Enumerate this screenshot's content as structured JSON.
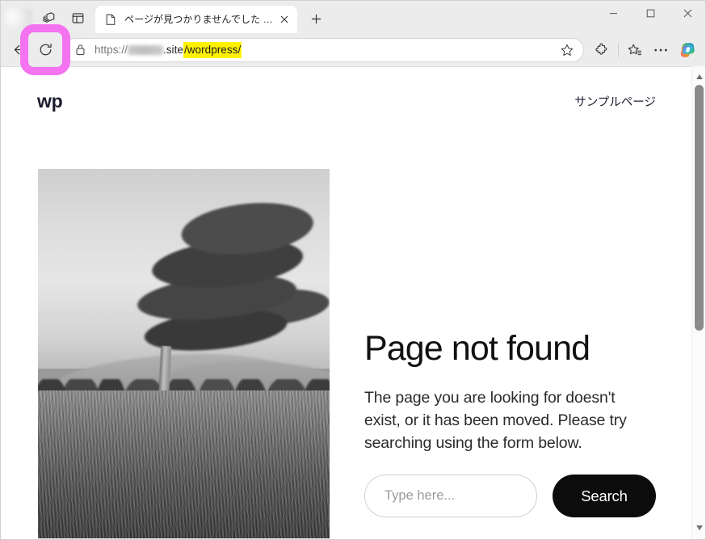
{
  "browser": {
    "tab": {
      "title": "ページが見つかりませんでした – wp",
      "favicon_name": "page-icon",
      "close_label": "×"
    },
    "new_tab_label": "+",
    "toolbar_icons": {
      "workspaces": "workspaces-icon",
      "tab_actions": "tab-actions-icon",
      "back": "back-arrow-icon",
      "refresh": "refresh-icon",
      "lock": "lock-icon",
      "favorite": "star-outline-icon",
      "extensions": "extensions-puzzle-icon",
      "collections": "collections-icon",
      "settings_more": "ellipsis-icon",
      "copilot": "copilot-icon"
    },
    "window_controls": {
      "minimize": "–",
      "maximize": "▢",
      "close": "✕"
    },
    "address_bar": {
      "scheme": "https://",
      "redacted_host": "",
      "tld": ".site",
      "path_highlighted": "/wordpress/",
      "highlight_color": "#fff200"
    },
    "annotation": {
      "target": "refresh-button",
      "color": "#f373f0"
    },
    "scrollbar": {
      "up_arrow": "▲",
      "down_arrow": "▼"
    }
  },
  "page": {
    "site_title": "wp",
    "nav": [
      {
        "label": "サンプルページ"
      }
    ],
    "hero_image_alt": "wind-swept tree in a grass field, black and white photograph",
    "heading": "Page not found",
    "body": "The page you are looking for doesn't exist, or it has been moved. Please try searching using the form below.",
    "search": {
      "placeholder": "Type here...",
      "value": "",
      "button_label": "Search"
    }
  }
}
